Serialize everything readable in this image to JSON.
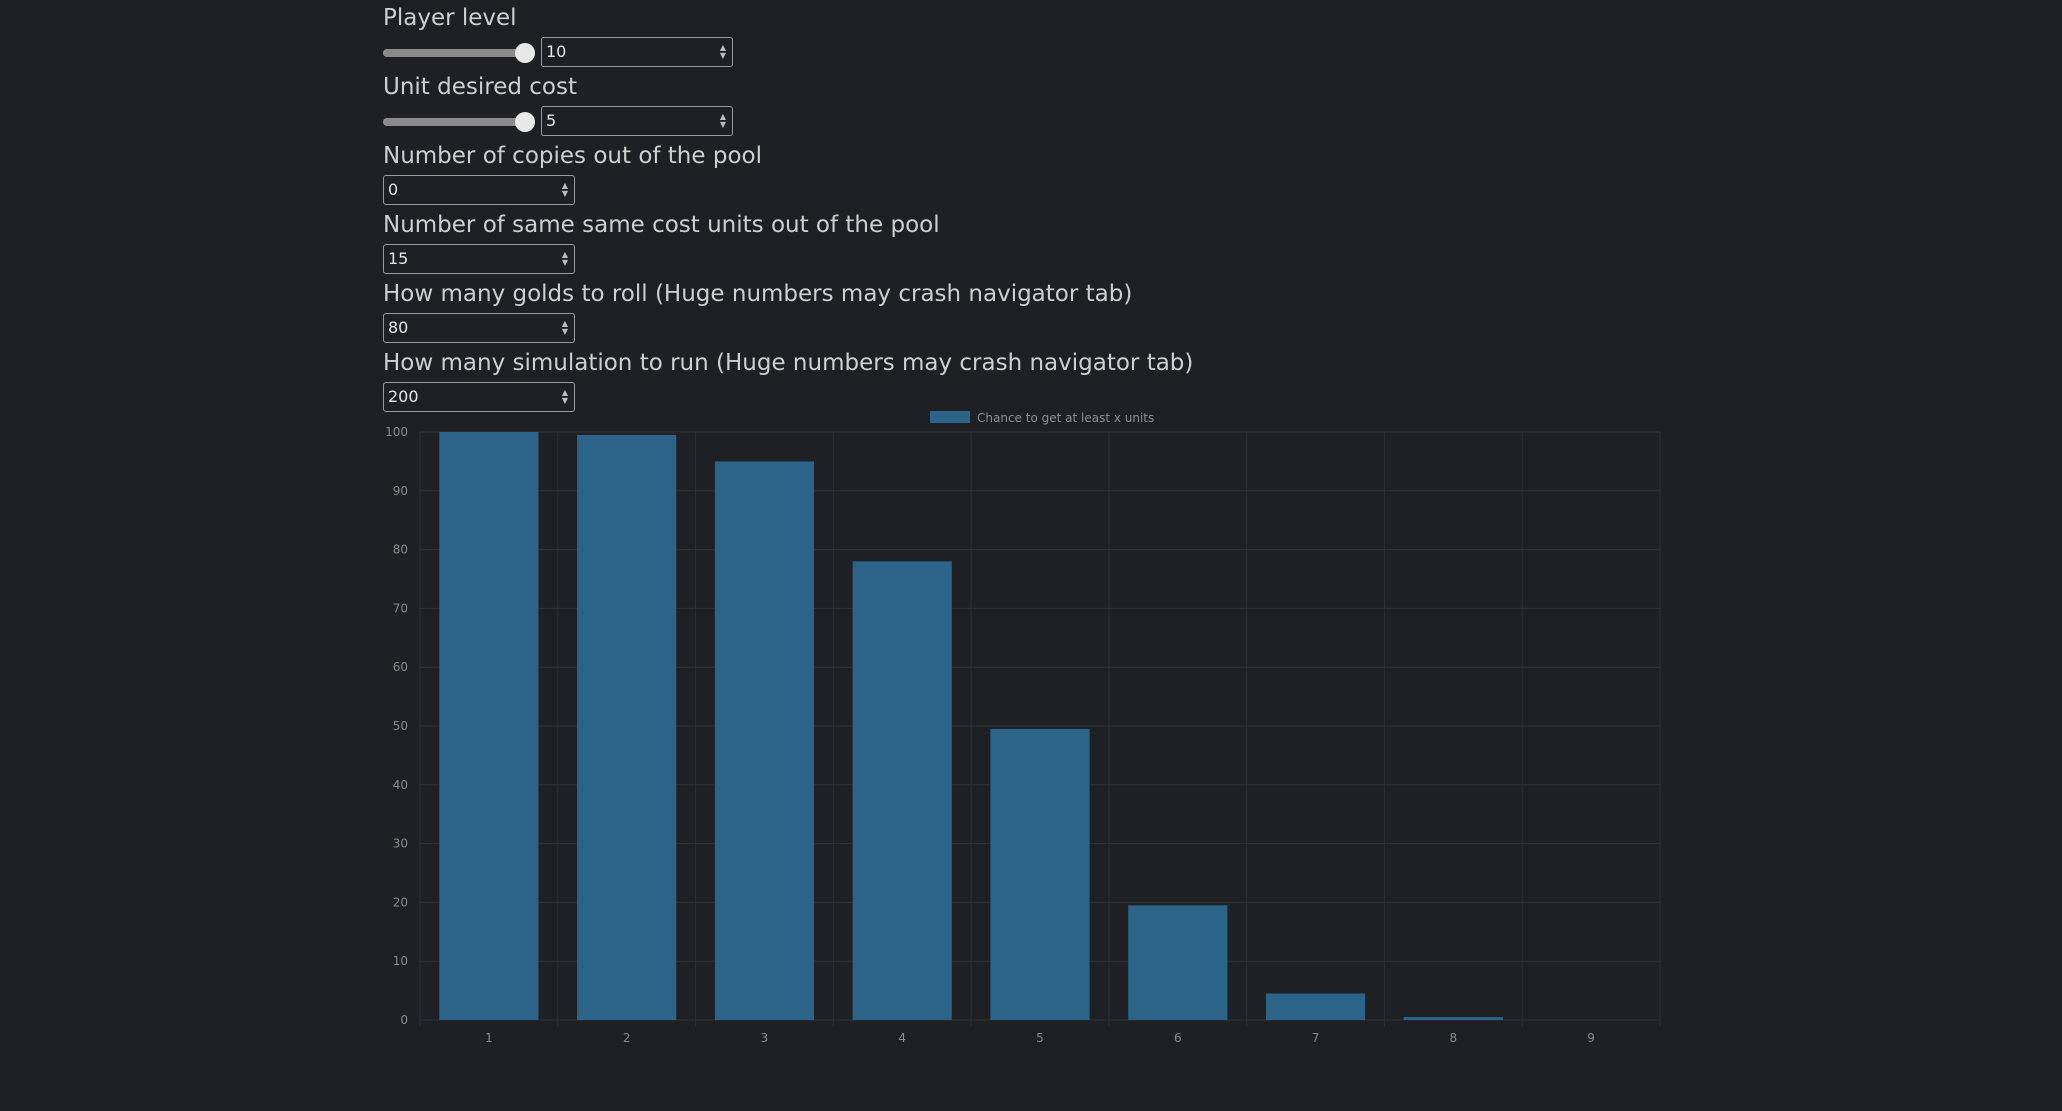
{
  "form": {
    "player_level": {
      "label": "Player level",
      "value": "10",
      "level": 10,
      "min": 1,
      "max": 10
    },
    "unit_cost": {
      "label": "Unit desired cost",
      "value": "5",
      "level": 5,
      "min": 1,
      "max": 5
    },
    "copies_out": {
      "label": "Number of copies out of the pool",
      "value": "0"
    },
    "same_cost_out": {
      "label": "Number of same same cost units out of the pool",
      "value": "15"
    },
    "golds": {
      "label": "How many golds to roll (Huge numbers may crash navigator tab)",
      "value": "80"
    },
    "simulations": {
      "label": "How many simulation to run (Huge numbers may crash navigator tab)",
      "value": "200"
    }
  },
  "colors": {
    "bar": "#2c6388",
    "grid": "#2f3033",
    "tick": "#8a8a8a",
    "legend_text": "#8f8f8f"
  },
  "chart_data": {
    "type": "bar",
    "categories": [
      "1",
      "2",
      "3",
      "4",
      "5",
      "6",
      "7",
      "8",
      "9"
    ],
    "series": [
      {
        "name": "Chance to get at least x units",
        "values": [
          100,
          99.5,
          95,
          78,
          49.5,
          19.5,
          4.5,
          0.5,
          0
        ]
      }
    ],
    "ylim": [
      0,
      100
    ],
    "yticks": [
      0,
      10,
      20,
      30,
      40,
      50,
      60,
      70,
      80,
      90,
      100
    ],
    "grid": true,
    "legend": "top-center"
  }
}
